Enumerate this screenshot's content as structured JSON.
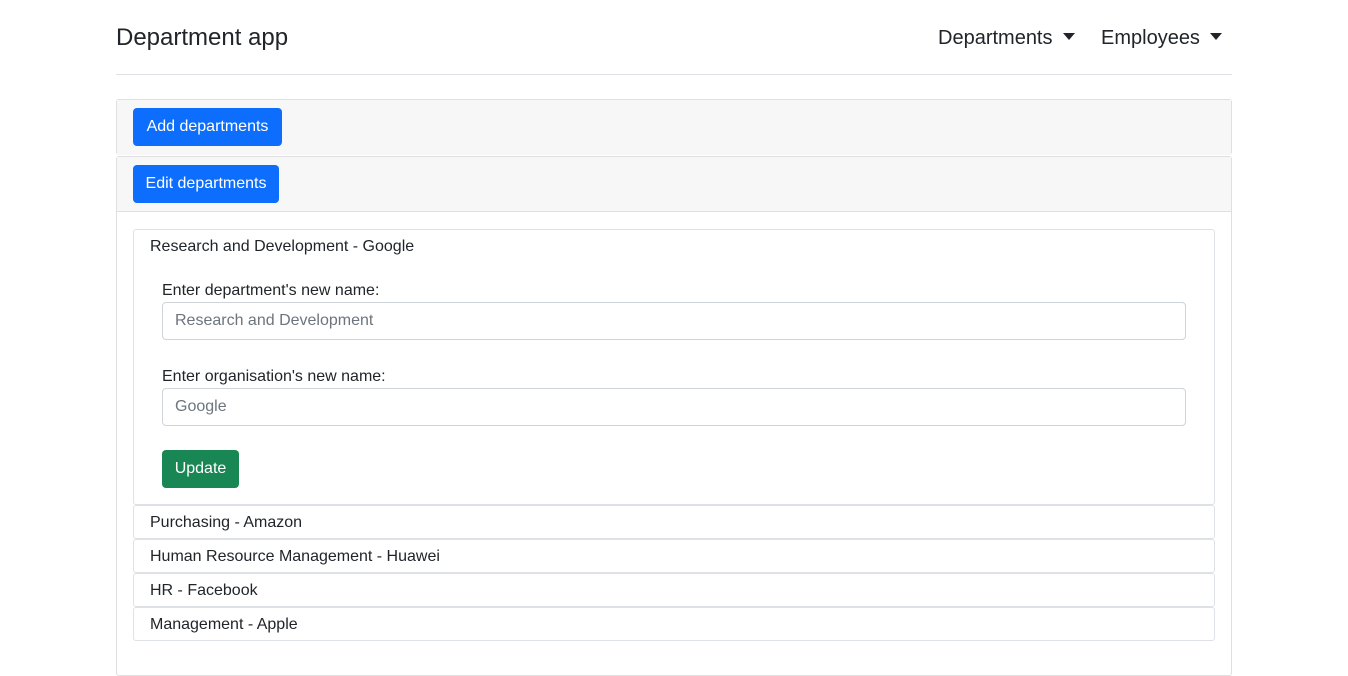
{
  "header": {
    "brand": "Department app",
    "nav": [
      {
        "label": "Departments"
      },
      {
        "label": "Employees"
      }
    ]
  },
  "accordion": {
    "add_label": "Add departments",
    "edit_label": "Edit departments"
  },
  "departments": [
    {
      "title": "Research and Development - Google"
    },
    {
      "title": "Purchasing - Amazon"
    },
    {
      "title": "Human Resource Management - Huawei"
    },
    {
      "title": "HR - Facebook"
    },
    {
      "title": "Management - Apple"
    }
  ],
  "edit_form": {
    "dept_label": "Enter department's new name:",
    "dept_placeholder": "Research and Development",
    "org_label": "Enter organisation's new name:",
    "org_placeholder": "Google",
    "update_label": "Update"
  },
  "colors": {
    "primary": "#0d6efd",
    "success": "#198754"
  }
}
